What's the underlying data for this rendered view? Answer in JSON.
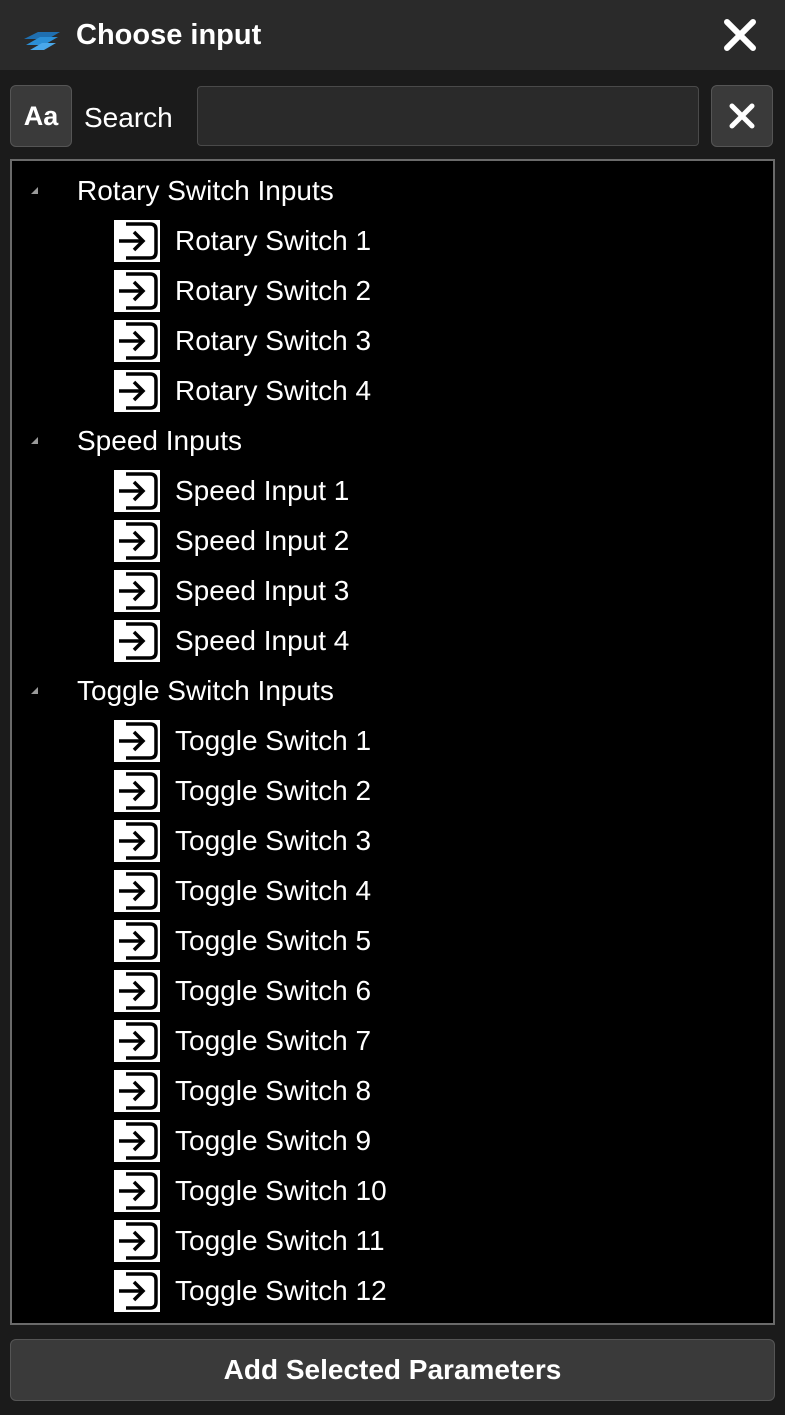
{
  "window": {
    "title": "Choose input",
    "logo_icon": "app-logo-icon",
    "close_icon": "close-icon"
  },
  "search": {
    "case_button_label": "Aa",
    "label": "Search",
    "value": "",
    "placeholder": "",
    "clear_icon": "close-icon"
  },
  "tree": {
    "groups": [
      {
        "label": "Rotary Switch Inputs",
        "expanded": true,
        "items": [
          {
            "label": "Rotary Switch 1",
            "icon": "input-icon"
          },
          {
            "label": "Rotary Switch 2",
            "icon": "input-icon"
          },
          {
            "label": "Rotary Switch 3",
            "icon": "input-icon"
          },
          {
            "label": "Rotary Switch 4",
            "icon": "input-icon"
          }
        ]
      },
      {
        "label": "Speed Inputs",
        "expanded": true,
        "items": [
          {
            "label": "Speed Input 1",
            "icon": "input-icon"
          },
          {
            "label": "Speed Input 2",
            "icon": "input-icon"
          },
          {
            "label": "Speed Input 3",
            "icon": "input-icon"
          },
          {
            "label": "Speed Input 4",
            "icon": "input-icon"
          }
        ]
      },
      {
        "label": "Toggle Switch Inputs",
        "expanded": true,
        "items": [
          {
            "label": "Toggle Switch 1",
            "icon": "input-icon"
          },
          {
            "label": "Toggle Switch 2",
            "icon": "input-icon"
          },
          {
            "label": "Toggle Switch 3",
            "icon": "input-icon"
          },
          {
            "label": "Toggle Switch 4",
            "icon": "input-icon"
          },
          {
            "label": "Toggle Switch 5",
            "icon": "input-icon"
          },
          {
            "label": "Toggle Switch 6",
            "icon": "input-icon"
          },
          {
            "label": "Toggle Switch 7",
            "icon": "input-icon"
          },
          {
            "label": "Toggle Switch 8",
            "icon": "input-icon"
          },
          {
            "label": "Toggle Switch 9",
            "icon": "input-icon"
          },
          {
            "label": "Toggle Switch 10",
            "icon": "input-icon"
          },
          {
            "label": "Toggle Switch 11",
            "icon": "input-icon"
          },
          {
            "label": "Toggle Switch 12",
            "icon": "input-icon"
          }
        ]
      }
    ]
  },
  "footer": {
    "add_button_label": "Add Selected Parameters"
  },
  "colors": {
    "background": "#1b1b1b",
    "titlebar": "#2a2a2a",
    "tree_background": "#000000",
    "button_background": "#3a3a3a",
    "logo_accent": "#2b8fd6",
    "text": "#ffffff"
  }
}
